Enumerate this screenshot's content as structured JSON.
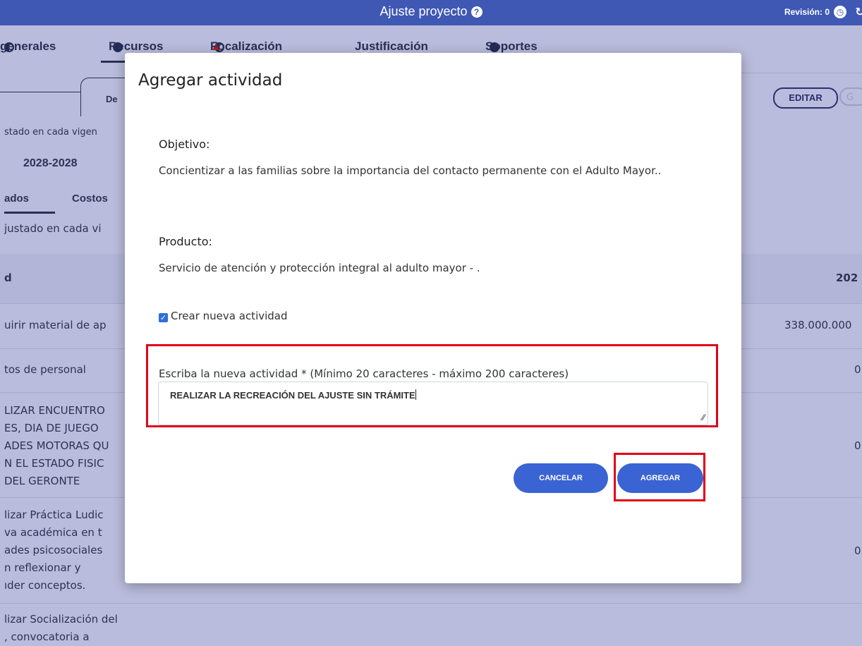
{
  "header": {
    "title": "Ajuste proyecto",
    "help_icon": "question-circle-icon",
    "revision": "Revisión: 0"
  },
  "tabs": [
    {
      "label": "generales",
      "status": "half"
    },
    {
      "label": "Recursos",
      "status": "full"
    },
    {
      "label": "Focalización",
      "status": "half",
      "warning": "▲"
    },
    {
      "label": "Justificación",
      "status": "empty"
    },
    {
      "label": "Soportes",
      "status": "full"
    }
  ],
  "background": {
    "sub_tab": "De",
    "editar_label": "EDITAR",
    "editar2_label": "G",
    "vigencia_note": "stado en cada vigen",
    "vigencia_year": "2028-2028",
    "sub_tabs": [
      "ados",
      "Costos"
    ],
    "ajustado_note": "justado en cada vi",
    "column_header_left": "d",
    "column_header_right": "202",
    "rows": [
      {
        "name": "uirir material de ap",
        "value": "338.000.000"
      },
      {
        "name": "tos de personal",
        "value": "0"
      },
      {
        "lines": [
          "LIZAR ENCUENTRO",
          "ES, DIA DE JUEGO",
          "ADES MOTORAS QU",
          "N EL ESTADO FISIC",
          "DEL GERONTE"
        ],
        "value": "0"
      },
      {
        "lines": [
          "lizar Práctica Ludic",
          "va académica en t",
          "ades psicosociales",
          "n reflexionar y",
          "ıder conceptos."
        ],
        "value": "0"
      },
      {
        "lines": [
          "lizar Socialización del",
          ", convocatoria a"
        ]
      }
    ]
  },
  "modal": {
    "title": "Agregar actividad",
    "objetivo_label": "Objetivo:",
    "objetivo_text": "Concientizar a las familias sobre la importancia del contacto permanente con el Adulto Mayor..",
    "producto_label": "Producto:",
    "producto_text": "Servicio de atención y protección integral al adulto mayor - .",
    "checkbox_label": "Crear nueva actividad",
    "field_label": "Escriba la nueva actividad * (Mínimo 20 caracteres - máximo 200 caracteres)",
    "field_value": "REALIZAR LA RECREACIÓN DEL AJUSTE SIN TRÁMITE",
    "cancel_label": "CANCELAR",
    "add_label": "AGREGAR"
  },
  "colors": {
    "header": "#3f58b4",
    "overlay": "#b9bcdc",
    "button": "#3a63d3",
    "highlight": "#e0001a"
  }
}
